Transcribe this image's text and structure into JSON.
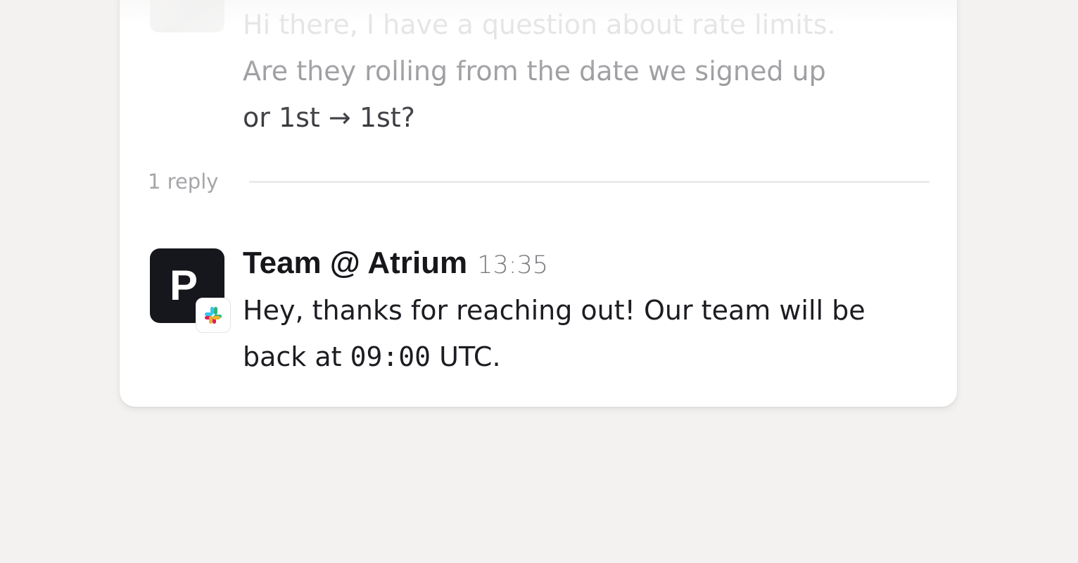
{
  "thread": {
    "original_message": {
      "line1": "Hi there, I have a question about rate limits.",
      "line2": "Are they rolling from the date we signed up",
      "line3": "or 1st → 1st?"
    },
    "reply_count_label": "1 reply",
    "reply": {
      "author": "Team @ Atrium",
      "time": "13:35",
      "avatar_letter": "P",
      "text_before_time": "Hey, thanks for reaching out! Our team will be back at ",
      "inline_time": "09:00",
      "text_after_time": " UTC.",
      "badge_icon": "slack-icon"
    }
  },
  "colors": {
    "background": "#f3f2f1",
    "card": "#ffffff",
    "avatar_dark": "#16171c",
    "slack_teal": "#36c5f0",
    "slack_green": "#2eb67d",
    "slack_red": "#e01e5a",
    "slack_yellow": "#ecb22e"
  }
}
